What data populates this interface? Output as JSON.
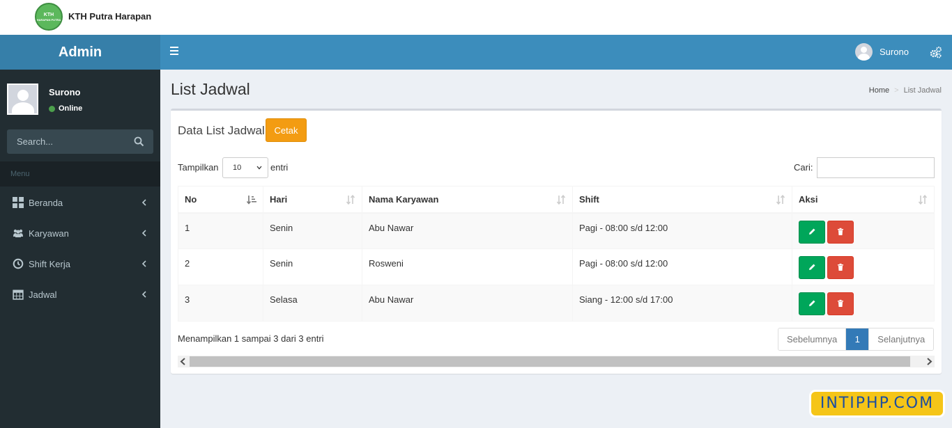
{
  "brand": {
    "logo_text": "KTH",
    "logo_subtext": "HARAPAN PUTRA",
    "name": "KTH Putra Harapan"
  },
  "header": {
    "logo": "Admin",
    "user_name": "Surono"
  },
  "sidebar": {
    "user_name": "Surono",
    "status": "Online",
    "search_placeholder": "Search...",
    "menu_header": "Menu",
    "items": [
      {
        "label": "Beranda",
        "icon": "dashboard-icon"
      },
      {
        "label": "Karyawan",
        "icon": "users-icon"
      },
      {
        "label": "Shift Kerja",
        "icon": "clock-icon"
      },
      {
        "label": "Jadwal",
        "icon": "calendar-icon"
      }
    ]
  },
  "page": {
    "title": "List Jadwal",
    "breadcrumb": [
      "Home",
      "List Jadwal"
    ]
  },
  "box": {
    "title": "Data List Jadwal",
    "print_label": "Cetak",
    "length_label_before": "Tampilkan",
    "length_value": "10",
    "length_label_after": "entri",
    "search_label": "Cari:",
    "search_value": ""
  },
  "table": {
    "columns": [
      "No",
      "Hari",
      "Nama Karyawan",
      "Shift",
      "Aksi"
    ],
    "rows": [
      {
        "no": "1",
        "hari": "Senin",
        "nama": "Abu Nawar",
        "shift": "Pagi - 08:00 s/d 12:00"
      },
      {
        "no": "2",
        "hari": "Senin",
        "nama": "Rosweni",
        "shift": "Pagi - 08:00 s/d 12:00"
      },
      {
        "no": "3",
        "hari": "Selasa",
        "nama": "Abu Nawar",
        "shift": "Siang - 12:00 s/d 17:00"
      }
    ]
  },
  "footer": {
    "info": "Menampilkan 1 sampai 3 dari 3 entri",
    "prev": "Sebelumnya",
    "current_page": "1",
    "next": "Selanjutnya"
  },
  "watermark": "INTIPHP.COM",
  "colors": {
    "navbar": "#3c8dbc",
    "sidebar": "#222d32",
    "warning": "#f39c12",
    "success": "#00a65a",
    "danger": "#dd4b39",
    "primary": "#337ab7"
  }
}
